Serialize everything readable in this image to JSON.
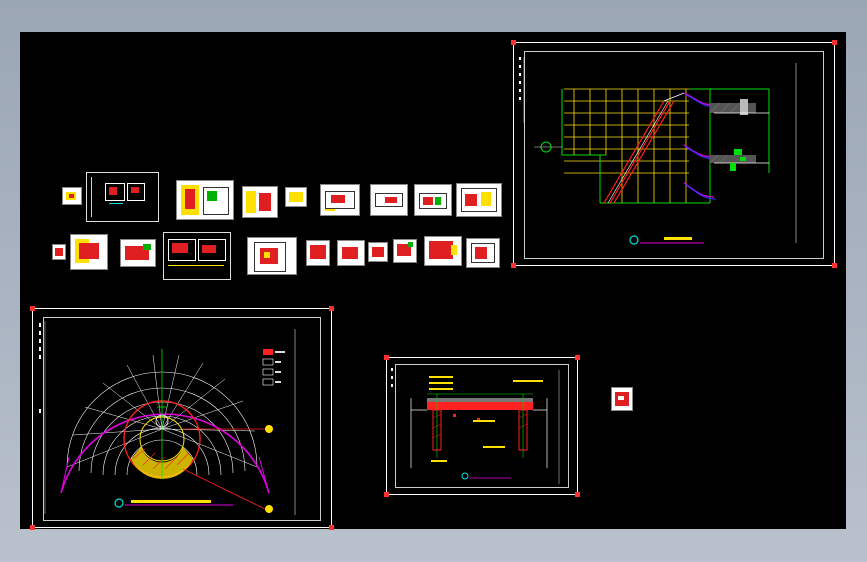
{
  "viewport": {
    "background": "#000000",
    "frame": "#a9b3c1"
  },
  "colors": {
    "yellow": "#ffe000",
    "green": "#00e000",
    "red": "#ff2020",
    "magenta": "#e000e0",
    "blue": "#3030ff",
    "cyan": "#00e0e0",
    "white": "#ffffff"
  },
  "drawings": [
    {
      "id": "stair-elevation",
      "kind": "drawing-sheet"
    },
    {
      "id": "fan-plan",
      "kind": "drawing-sheet"
    },
    {
      "id": "section-detail",
      "kind": "drawing-sheet"
    }
  ],
  "thumbnail_rows": {
    "row1_count": 10,
    "row2_count": 12
  },
  "icons": [
    "north-arrow-icon",
    "title-block-icon",
    "stamp-icon"
  ]
}
